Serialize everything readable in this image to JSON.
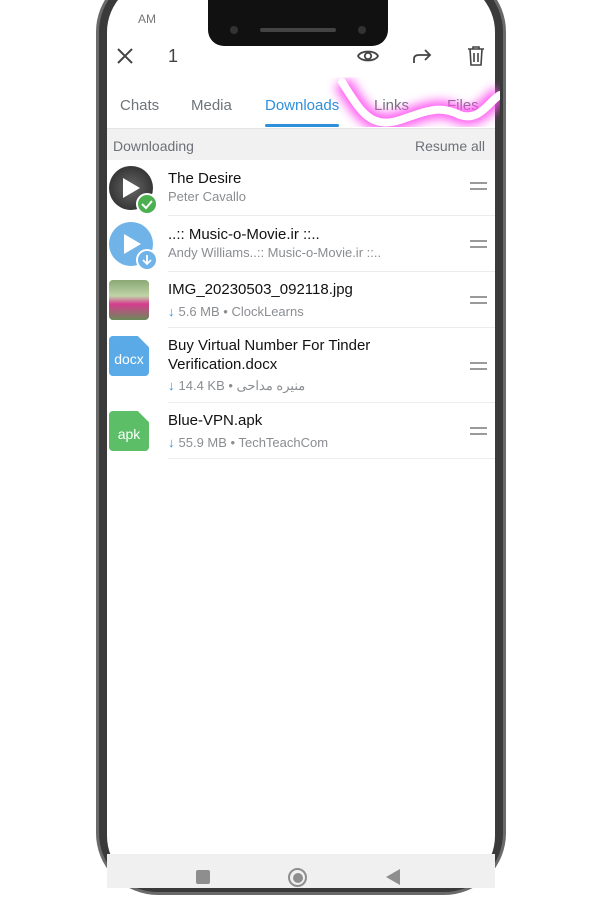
{
  "status_bar": {
    "time": "AM"
  },
  "toolbar": {
    "selected_count": "1",
    "icons": [
      "close-icon",
      "eye-icon",
      "forward-icon",
      "trash-icon"
    ]
  },
  "tabs": [
    {
      "label": "Chats"
    },
    {
      "label": "Media"
    },
    {
      "label": "Downloads",
      "active": true
    },
    {
      "label": "Links"
    },
    {
      "label": "Files"
    }
  ],
  "section": {
    "title": "Downloading",
    "action": "Resume all"
  },
  "items": [
    {
      "title": "The Desire",
      "subtitle": "Peter Cavallo",
      "type": "audio",
      "status": "downloaded"
    },
    {
      "title": "..:: Music-o-Movie.ir ::..",
      "subtitle": "Andy Williams..:: Music-o-Movie.ir ::..",
      "type": "audio",
      "status": "downloading"
    },
    {
      "title": "IMG_20230503_092118.jpg",
      "size": "5.6 MB",
      "source": "ClockLearns",
      "type": "image"
    },
    {
      "title": "Buy Virtual Number For Tinder Verification.docx",
      "size": "14.4 KB",
      "source": "منیره مداحی",
      "type": "docx",
      "badge": "docx"
    },
    {
      "title": "Blue-VPN.apk",
      "size": "55.9 MB",
      "source": "TechTeachCom",
      "type": "apk",
      "badge": "apk"
    }
  ],
  "colors": {
    "accent": "#2f8fd8",
    "docx": "#5aaae8",
    "apk": "#5cbf68",
    "success": "#4caf50",
    "scribble": "#ff4df0"
  }
}
